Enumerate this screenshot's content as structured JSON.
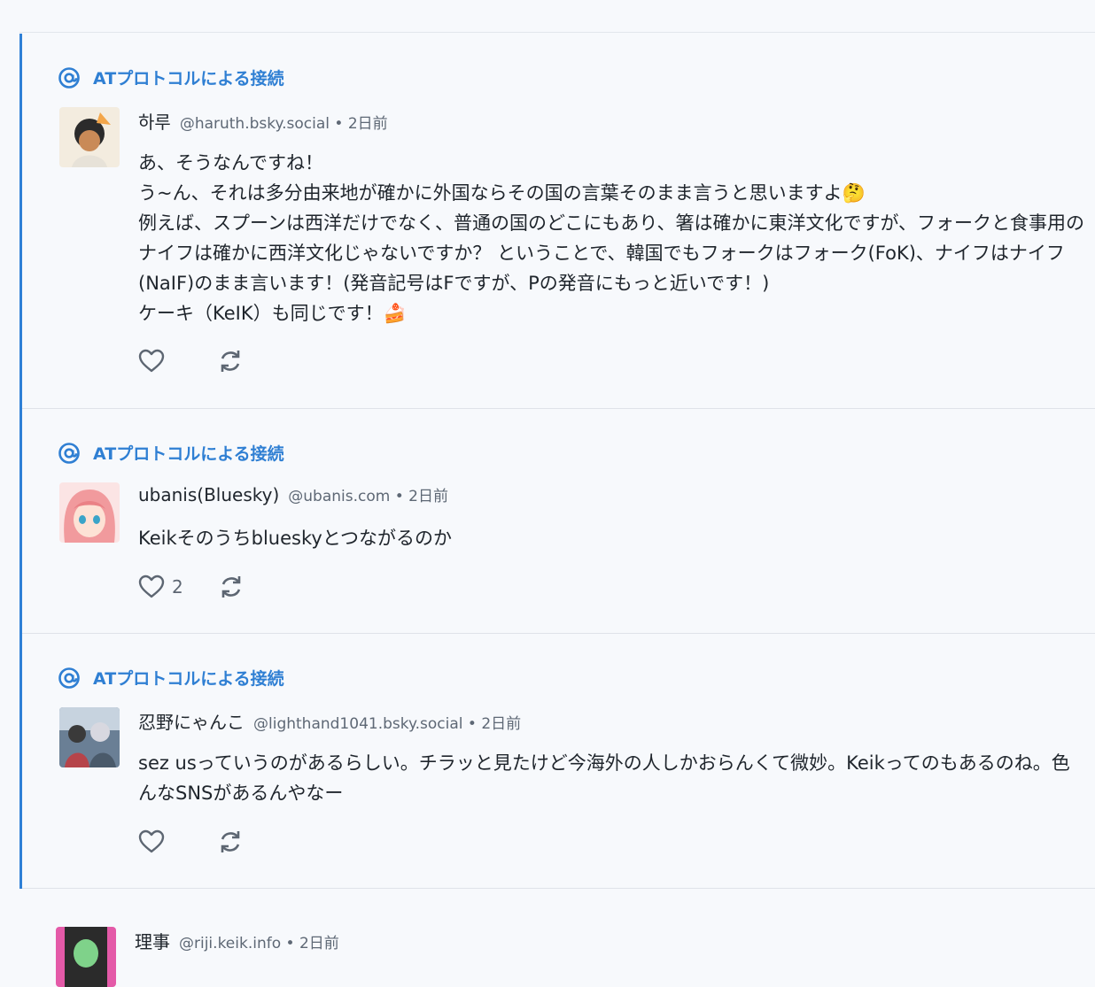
{
  "source_label": "ATプロトコルによる接続",
  "posts": [
    {
      "name": "하루",
      "handle_time": "@haruth.bsky.social • 2日前",
      "text": "あ、そうなんですね！\nう~ん、それは多分由来地が確かに外国ならその国の言葉そのまま言うと思いますよ🤔\n例えば、スプーンは西洋だけでなく、普通の国のどこにもあり、箸は確かに東洋文化ですが、フォークと食事用のナイフは確かに西洋文化じゃないですか？ ということで、韓国でもフォークはフォーク(FoK)、ナイフはナイフ(NaIF)のまま言います！(発音記号はFですが、Pの発音にもっと近いです！)\nケーキ（KeIK）も同じです！🍰",
      "likes": "",
      "like_icon": "heart-icon",
      "repost_icon": "repost-icon"
    },
    {
      "name": "ubanis(Bluesky)",
      "handle_time": "@ubanis.com • 2日前",
      "text": "Keikそのうちblueskyとつながるのか",
      "likes": "2",
      "like_icon": "heart-icon",
      "repost_icon": "repost-icon"
    },
    {
      "name": "忍野にゃんこ",
      "handle_time": "@lighthand1041.bsky.social • 2日前",
      "text": "sez usっていうのがあるらしい。チラッと見たけど今海外の人しかおらんくて微妙。Keikってのもあるのね。色んなSNSがあるんやなー",
      "likes": "",
      "like_icon": "heart-icon",
      "repost_icon": "repost-icon"
    }
  ],
  "next_post": {
    "name": "理事",
    "handle_time": "@riji.keik.info • 2日前"
  },
  "colors": {
    "accent": "#2f80d6",
    "background": "#f7f9fc",
    "muted": "#5e6875"
  }
}
